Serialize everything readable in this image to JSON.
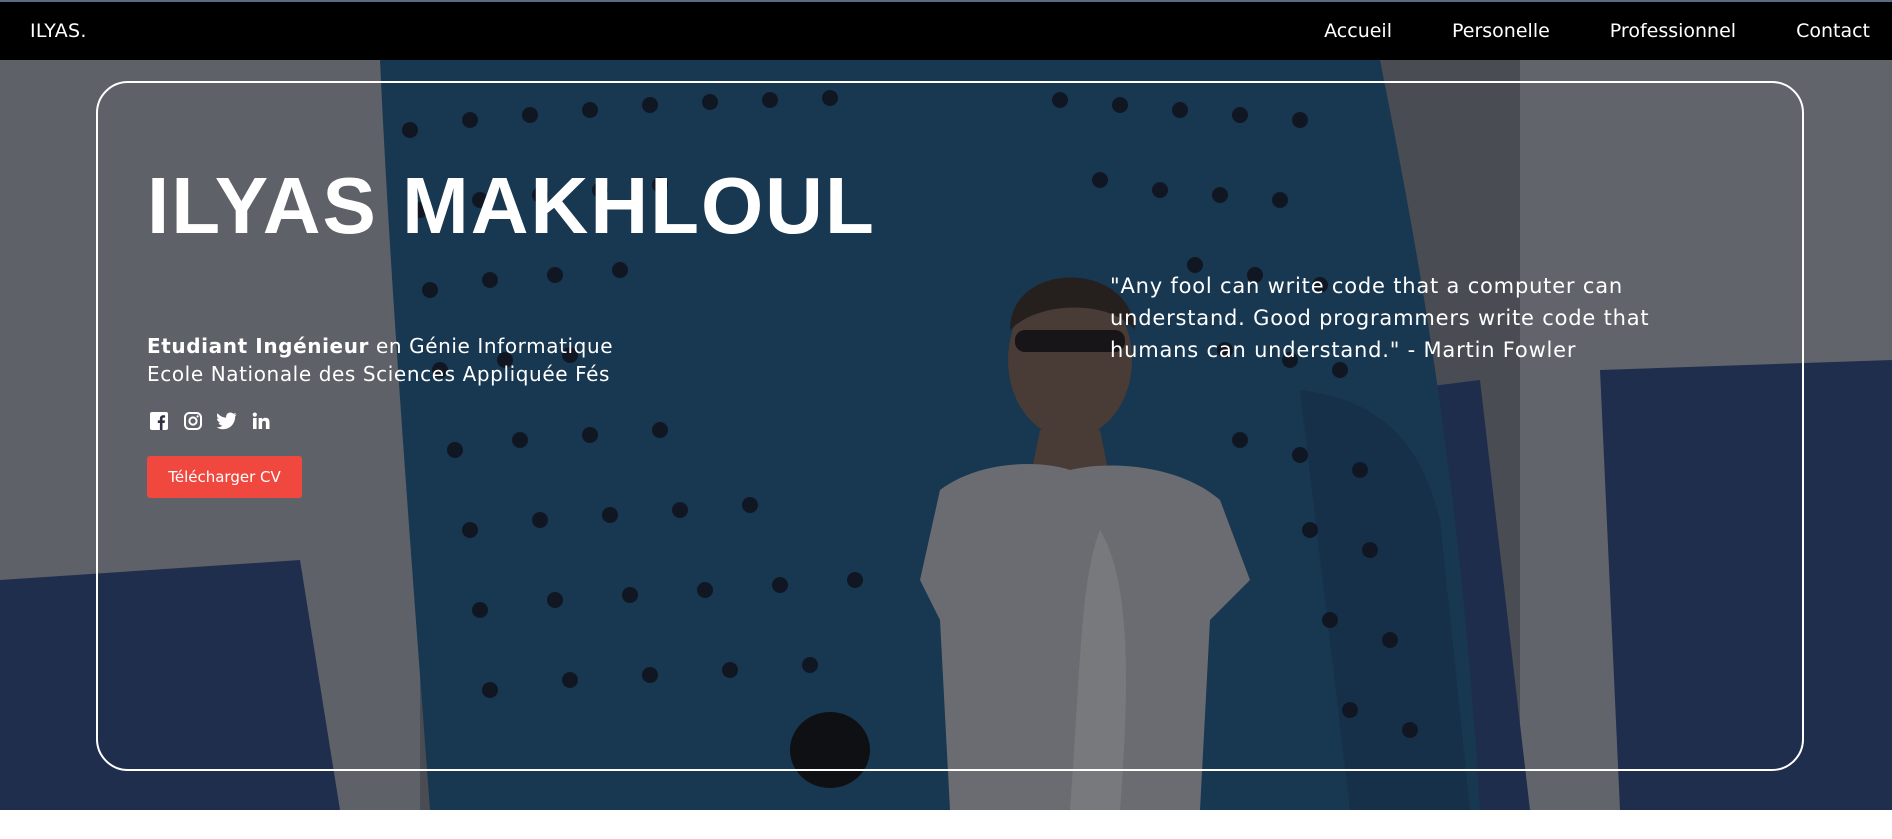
{
  "navbar": {
    "brand": "ILYAS.",
    "links": [
      {
        "label": "Accueil"
      },
      {
        "label": "Personelle"
      },
      {
        "label": "Professionnel"
      },
      {
        "label": "Contact"
      }
    ]
  },
  "hero": {
    "name": "ILYAS MAKHLOUL",
    "subtitle": {
      "line1_bold": "Etudiant Ingénieur",
      "line1_rest": " en Génie Informatique",
      "line2": "Ecole Nationale des Sciences Appliquée Fés"
    },
    "socials": [
      {
        "icon": "facebook-icon"
      },
      {
        "icon": "instagram-icon"
      },
      {
        "icon": "twitter-icon"
      },
      {
        "icon": "linkedin-icon"
      }
    ],
    "cv_button": "Télécharger CV",
    "quote": "\"Any fool can write code that a computer can understand. Good programmers write code that humans can understand.\" - Martin Fowler"
  },
  "colors": {
    "navbar_bg": "#000000",
    "button_accent": "#f0483e",
    "text": "#ffffff"
  }
}
